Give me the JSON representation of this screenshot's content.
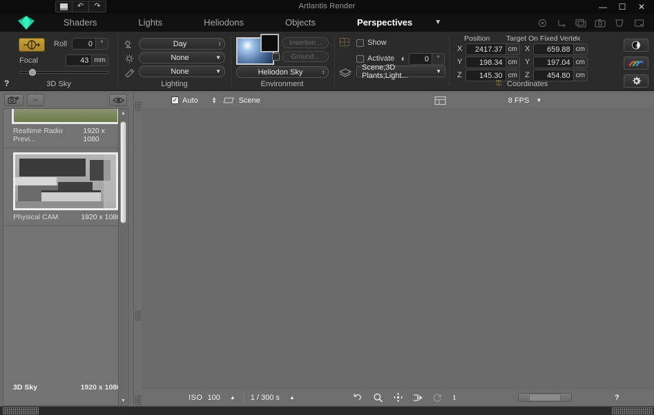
{
  "window": {
    "app_title": "Artlantis Render",
    "quick_buttons": [
      {
        "name": "save-icon",
        "glyph": ""
      },
      {
        "name": "undo-icon",
        "glyph": "↶"
      },
      {
        "name": "redo-icon",
        "glyph": "↷"
      }
    ],
    "system_buttons": [
      {
        "name": "minimize-button",
        "glyph": "—"
      },
      {
        "name": "maximize-button",
        "glyph": "☐"
      },
      {
        "name": "close-button",
        "glyph": "✕"
      }
    ]
  },
  "menubar": {
    "items": [
      {
        "label": "Shaders",
        "active": false
      },
      {
        "label": "Lights",
        "active": false
      },
      {
        "label": "Heliodons",
        "active": false
      },
      {
        "label": "Objects",
        "active": false
      },
      {
        "label": "Perspectives",
        "active": true
      }
    ],
    "caret": "▼",
    "right_icons": [
      {
        "name": "target-icon"
      },
      {
        "name": "axes-icon"
      },
      {
        "name": "copy-icon"
      },
      {
        "name": "camera-icon"
      },
      {
        "name": "crop-icon"
      },
      {
        "name": "frame-icon"
      }
    ]
  },
  "toolbar": {
    "help_glyph": "?",
    "sky": {
      "group_label": "3D Sky",
      "perspective_toggle_name": "perspective-toggle-button",
      "roll_label": "Roll",
      "roll_value": "0",
      "roll_unit": "°",
      "focal_label": "Focal",
      "focal_value": "43",
      "focal_unit": "mm",
      "slider_percent": 13
    },
    "lighting": {
      "group_label": "Lighting",
      "rows": [
        {
          "icon": "heliodon-icon",
          "value": "Day",
          "arrow": "↕"
        },
        {
          "icon": "light-bulb-icon",
          "value": "None",
          "arrow": "▼"
        },
        {
          "icon": "shader-icon",
          "value": "None",
          "arrow": "▼"
        }
      ]
    },
    "environment": {
      "group_label": "Environment",
      "preview_name": "environment-preview",
      "swatch_name": "background-color-swatch",
      "insertion_button": "Insertion...",
      "ground_button": "Ground...",
      "ground_checkbox_checked": false,
      "combo_value": "Heliodon Sky",
      "combo_arrow": "↕"
    },
    "scene": {
      "show_label": "Show",
      "show_checked": false,
      "activate_label": "Activate",
      "activate_checked": false,
      "angle_value": "0",
      "angle_unit": "°",
      "layers_value": "Scene;3D Plants;Light...",
      "layers_arrow": "▼"
    },
    "coordinates": {
      "group_label": "Coordinates",
      "lock_glyph": "⚿",
      "position_label": "Position",
      "target_label": "Target On Fixed Vertex",
      "target_arrow": "↕",
      "position": [
        {
          "axis": "X",
          "value": "2417.37",
          "unit": "cm"
        },
        {
          "axis": "Y",
          "value": "198.34",
          "unit": "cm"
        },
        {
          "axis": "Z",
          "value": "145.30",
          "unit": "cm"
        }
      ],
      "target": [
        {
          "axis": "X",
          "value": "659.88",
          "unit": "cm"
        },
        {
          "axis": "Y",
          "value": "197.04",
          "unit": "cm"
        },
        {
          "axis": "Z",
          "value": "454.80",
          "unit": "cm"
        }
      ]
    },
    "side_buttons": [
      {
        "name": "contrast-button"
      },
      {
        "name": "color-correction-button"
      },
      {
        "name": "settings-gear-button"
      }
    ]
  },
  "sidebar": {
    "add_button_name": "add-view-button",
    "remove_button_label": "–",
    "preview_button_name": "preview-eye-button",
    "items": [
      {
        "name": "Realtime Radio Previ...",
        "dimensions": "1920 x 1080",
        "selected": false
      },
      {
        "name": "Physical CAM",
        "dimensions": "1920 x 1080",
        "selected": true
      },
      {
        "name": "3D Sky",
        "dimensions": "1920 x 1080",
        "selected": false
      }
    ],
    "scroll_up": "▲",
    "scroll_down": "▼"
  },
  "viewport": {
    "auto_label": "Auto",
    "auto_checked": true,
    "scene_label": "Scene",
    "stepper_up": "▲",
    "stepper_down": "▼",
    "layout_icon_name": "split-view-icon",
    "fps_value": "8 FPS",
    "fps_arrow": "▼"
  },
  "bottombar": {
    "iso_label": "ISO",
    "iso_value": "100",
    "iso_arrow": "▲",
    "shutter_value": "1 / 300 s",
    "shutter_arrow": "▲",
    "tools": [
      {
        "name": "undo-tool-icon",
        "glyph": "↺"
      },
      {
        "name": "zoom-tool-icon",
        "glyph": "⌕"
      },
      {
        "name": "pan-tool-icon",
        "glyph": "✥"
      },
      {
        "name": "enter-tool-icon",
        "glyph": "⇥"
      },
      {
        "name": "refresh-tool-icon",
        "glyph": "↻"
      },
      {
        "name": "info-tool-icon",
        "glyph": "ı"
      }
    ],
    "help_glyph": "?"
  }
}
